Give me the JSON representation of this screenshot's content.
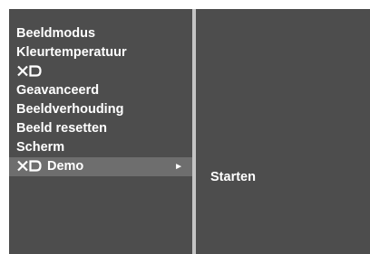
{
  "menu": {
    "items": [
      {
        "label": "Beeldmodus"
      },
      {
        "label": "Kleurtemperatuur"
      },
      {
        "logo": "xd-logo"
      },
      {
        "label": "Geavanceerd"
      },
      {
        "label": "Beeldverhouding"
      },
      {
        "label": "Beeld resetten"
      },
      {
        "label": "Scherm"
      },
      {
        "logo": "xd-logo",
        "label": "Demo",
        "selected": true,
        "arrow": "►"
      }
    ]
  },
  "submenu": {
    "items": [
      {
        "label": "Starten"
      }
    ]
  },
  "colors": {
    "panel_bg": "#4d4d4d",
    "selected_bg": "#6e6e6e",
    "divider": "#c4c4c4",
    "text": "#ffffff"
  }
}
